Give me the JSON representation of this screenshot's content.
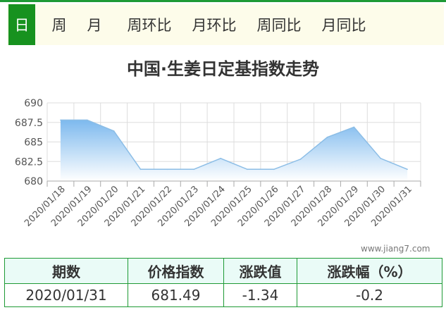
{
  "tabs": {
    "day": "日",
    "week": "周",
    "month": "月",
    "week_mom": "周环比",
    "month_mom": "月环比",
    "week_yoy": "周同比",
    "month_yoy": "月同比"
  },
  "watermark": "www.jiang7.com",
  "chart_data": {
    "type": "area",
    "title": "中国·生姜日定基指数走势",
    "x": [
      "2020/01/18",
      "2020/01/19",
      "2020/01/20",
      "2020/01/21",
      "2020/01/22",
      "2020/01/23",
      "2020/01/24",
      "2020/01/25",
      "2020/01/26",
      "2020/01/27",
      "2020/01/28",
      "2020/01/29",
      "2020/01/30",
      "2020/01/31"
    ],
    "series": [
      {
        "values": [
          687.8,
          687.8,
          686.4,
          681.5,
          681.5,
          681.5,
          682.9,
          681.5,
          681.5,
          682.8,
          685.6,
          686.9,
          682.9,
          681.5
        ]
      }
    ],
    "yticks": [
      "690",
      "687.5",
      "685",
      "682.5",
      "680"
    ],
    "ylim": [
      680,
      690
    ],
    "grid": true,
    "colors": {
      "line": "#8bbde6",
      "fill_top": "#7db9ee",
      "fill_bottom": "#ffffff"
    }
  },
  "table": {
    "headers": [
      "期数",
      "价格指数",
      "涨跌值",
      "涨跌幅（%）"
    ],
    "row": [
      "2020/01/31",
      "681.49",
      "-1.34",
      "-0.2"
    ]
  }
}
